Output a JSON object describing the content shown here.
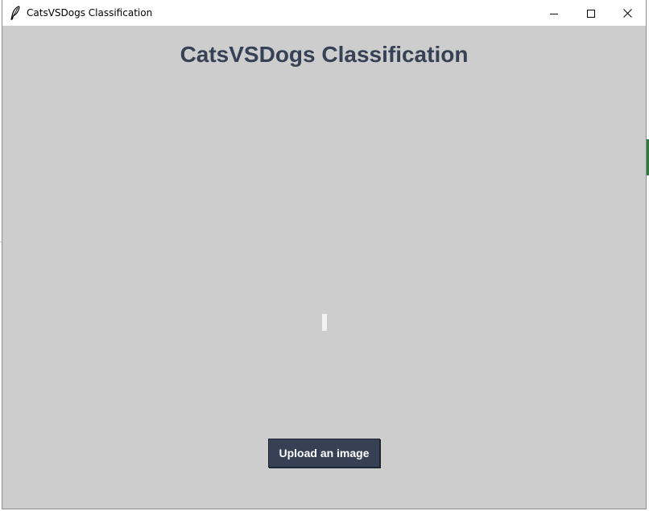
{
  "window": {
    "title": "CatsVSDogs Classification",
    "controls": {
      "minimize_icon": "minimize-icon",
      "maximize_icon": "maximize-icon",
      "close_icon": "close-icon"
    }
  },
  "main": {
    "heading": "CatsVSDogs Classification",
    "upload_button_label": "Upload an image"
  },
  "colors": {
    "background": "#cdcdcd",
    "heading": "#364156",
    "button_bg": "#364156",
    "button_text": "#ffffff"
  }
}
